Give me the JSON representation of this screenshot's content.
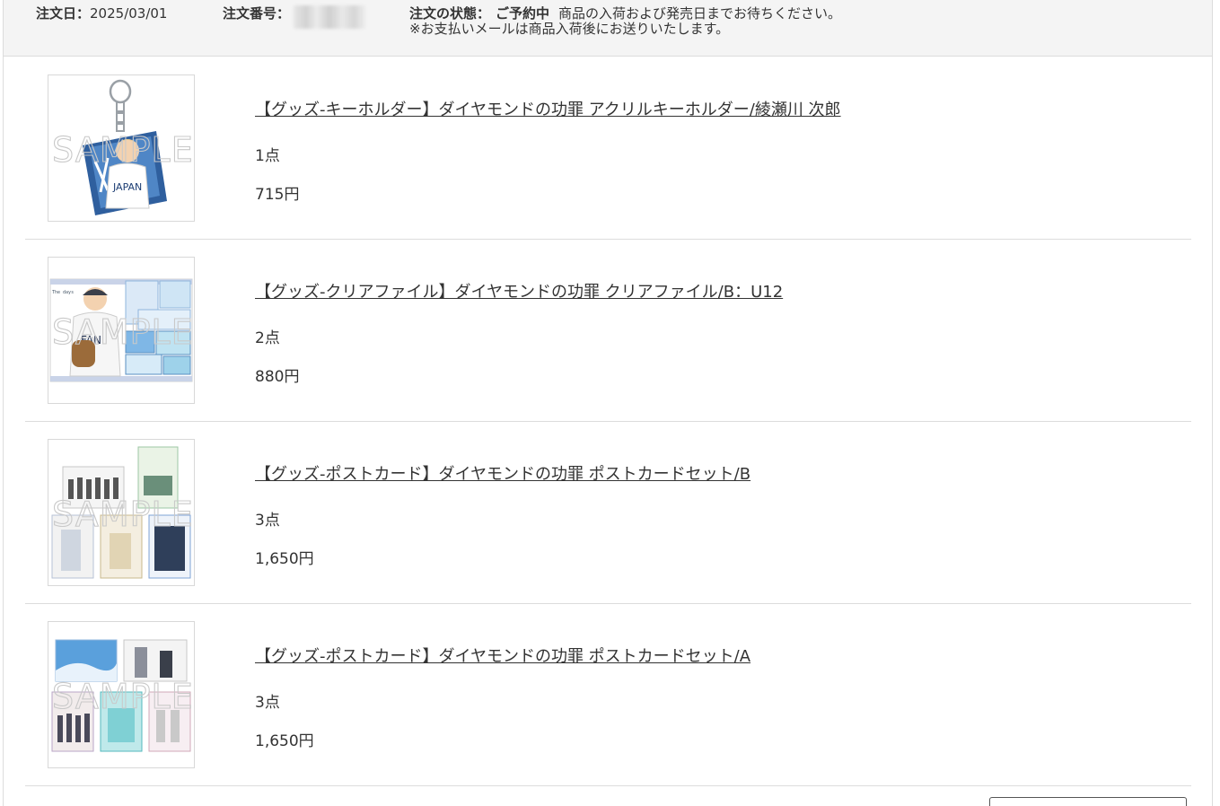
{
  "order": {
    "date_label": "注文日：",
    "date_value": "2025/03/01",
    "number_label": "注文番号：",
    "status_label": "注文の状態：",
    "status_value": "ご予約中",
    "status_message": "商品の入荷および発売日までお待ちください。",
    "status_note": "※お支払いメールは商品入荷後にお送りいたします。"
  },
  "watermark": "SAMPLE",
  "items": [
    {
      "title": "【グッズ-キーホルダー】ダイヤモンドの功罪 アクリルキーホルダー/綾瀬川 次郎",
      "quantity": "1点",
      "price": "715円",
      "thumb_icon": "acrylic-keychain-image"
    },
    {
      "title": "【グッズ-クリアファイル】ダイヤモンドの功罪 クリアファイル/B：U12",
      "quantity": "2点",
      "price": "880円",
      "thumb_icon": "clear-file-image"
    },
    {
      "title": "【グッズ-ポストカード】ダイヤモンドの功罪 ポストカードセット/B",
      "quantity": "3点",
      "price": "1,650円",
      "thumb_icon": "postcard-set-image"
    },
    {
      "title": "【グッズ-ポストカード】ダイヤモンドの功罪 ポストカードセット/A",
      "quantity": "3点",
      "price": "1,650円",
      "thumb_icon": "postcard-set-image"
    }
  ],
  "colors": {
    "header_bg": "#f4f4f4",
    "border": "#dcdcdc",
    "text": "#333333"
  }
}
